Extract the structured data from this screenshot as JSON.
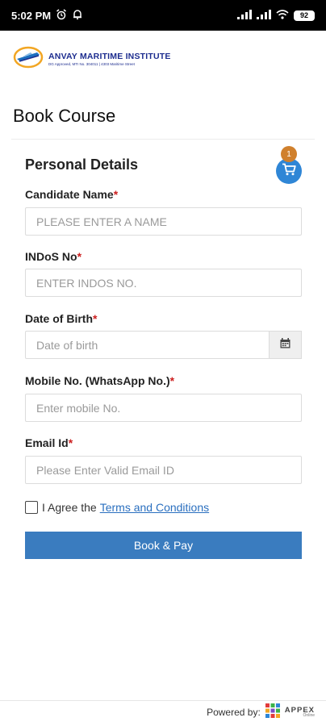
{
  "status_bar": {
    "time": "5:02 PM",
    "battery": "92"
  },
  "header": {
    "logo_title": "ANVAY MARITIME INSTITUTE",
    "logo_subtitle": "DG Approved, MTI No. 304011 | 4303 Maritime Street"
  },
  "page": {
    "title": "Book Course"
  },
  "form": {
    "section_title": "Personal Details",
    "cart_count": "1",
    "fields": {
      "candidate_name": {
        "label": "Candidate Name",
        "required": "*",
        "placeholder": "PLEASE ENTER A NAME",
        "value": ""
      },
      "indos_no": {
        "label": "INDoS No",
        "required": "*",
        "placeholder": "ENTER INDOS NO.",
        "value": ""
      },
      "dob": {
        "label": "Date of Birth",
        "required": "*",
        "placeholder": "Date of birth",
        "value": ""
      },
      "mobile": {
        "label": "Mobile No. (WhatsApp No.)",
        "required": "*",
        "placeholder": "Enter mobile No.",
        "value": ""
      },
      "email": {
        "label": "Email Id",
        "required": "*",
        "placeholder": "Please Enter Valid Email ID",
        "value": ""
      }
    },
    "agree_prefix": "I Agree the",
    "terms_link": "Terms and Conditions",
    "agree_checked": false,
    "submit_label": "Book & Pay"
  },
  "footer": {
    "powered_by": "Powered by:",
    "brand": "APPEX",
    "brand_sub": "Online"
  },
  "colors": {
    "accent": "#3a7cbf",
    "cart": "#2f86d6",
    "badge": "#d0802d",
    "required": "#cc2020",
    "link": "#2a6fbf"
  },
  "icons": {
    "cart": "shopping-cart-icon",
    "calendar": "calendar-icon",
    "alarm": "alarm-icon",
    "bell": "bell-icon",
    "signal": "signal-icon",
    "wifi": "wifi-icon"
  }
}
